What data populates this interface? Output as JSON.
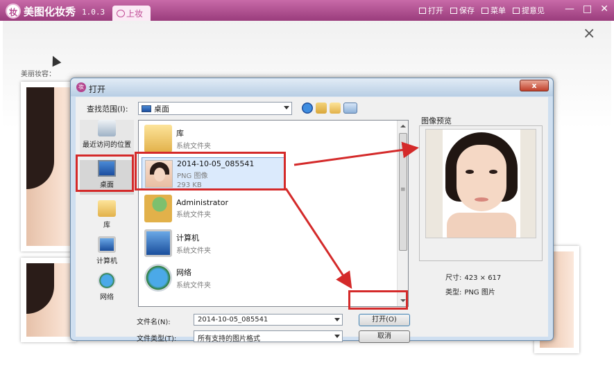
{
  "app": {
    "logo_text": "妆",
    "name": "美图化妆秀",
    "version": "1.0.3",
    "active_tab": "上妆",
    "menu": [
      {
        "label": "打开",
        "icon": "folder-open-icon"
      },
      {
        "label": "保存",
        "icon": "save-icon"
      },
      {
        "label": "菜单",
        "icon": "menu-icon"
      },
      {
        "label": "提意见",
        "icon": "feedback-icon"
      }
    ],
    "window_controls": {
      "minimize": "—",
      "maximize": "□",
      "close": "✕"
    },
    "panel_close": "×",
    "makeup_label": "美丽妆容："
  },
  "dialog": {
    "title": "打开",
    "close_label": "x",
    "lookin_label": "查找范围(I):",
    "lookin_value": "桌面",
    "places": [
      {
        "label": "最近访问的位置",
        "icon": "recent-places-icon"
      },
      {
        "label": "桌面",
        "icon": "desktop-icon"
      },
      {
        "label": "库",
        "icon": "library-icon"
      },
      {
        "label": "计算机",
        "icon": "computer-icon"
      },
      {
        "label": "网络",
        "icon": "network-icon"
      }
    ],
    "files": [
      {
        "name": "库",
        "type": "系统文件夹",
        "size": ""
      },
      {
        "name": "2014-10-05_085541",
        "type": "PNG 图像",
        "size": "293 KB"
      },
      {
        "name": "Administrator",
        "type": "系统文件夹",
        "size": ""
      },
      {
        "name": "计算机",
        "type": "系统文件夹",
        "size": ""
      },
      {
        "name": "网络",
        "type": "系统文件夹",
        "size": ""
      }
    ],
    "scroll_mark": "≡",
    "filename_label": "文件名(N):",
    "filename_value": "2014-10-05_085541",
    "filetype_label": "文件类型(T):",
    "filetype_value": "所有支持的图片格式",
    "open_button": "打开(O)",
    "cancel_button": "取消",
    "preview": {
      "label": "图像预览",
      "size_label": "尺寸:",
      "size_value": "423 × 617",
      "type_label": "类型:",
      "type_value": "PNG 图片"
    }
  },
  "colors": {
    "title_bar": "#b04a8e",
    "annotation_red": "#d42a2a",
    "dialog_frame": "#cfdff0"
  }
}
